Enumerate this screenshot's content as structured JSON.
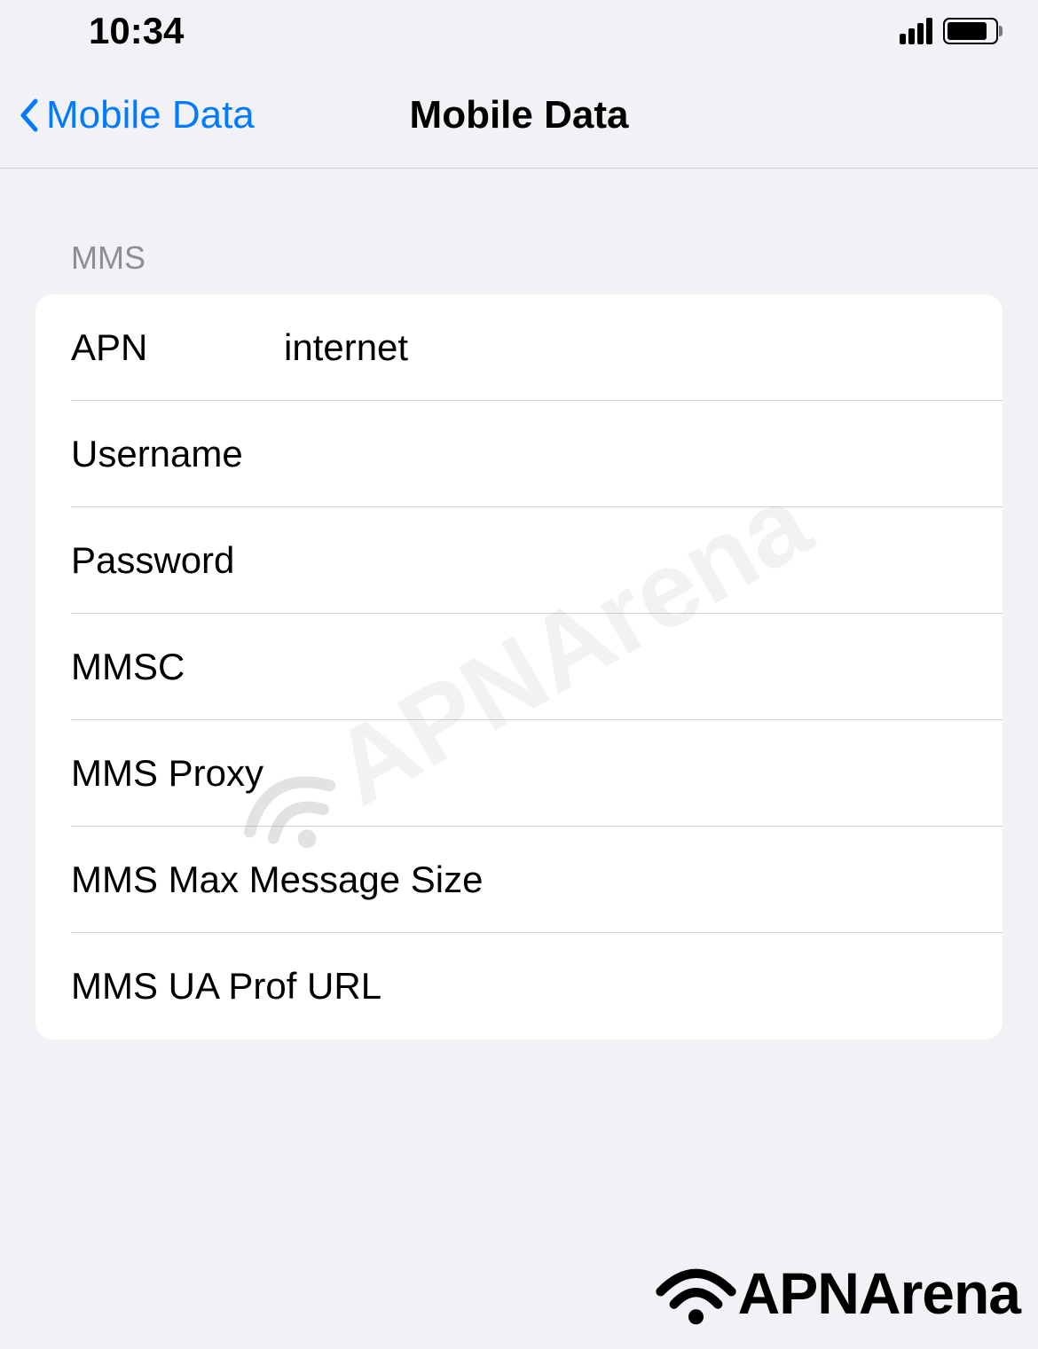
{
  "statusBar": {
    "time": "10:34"
  },
  "navBar": {
    "backLabel": "Mobile Data",
    "title": "Mobile Data"
  },
  "section": {
    "header": "MMS",
    "rows": [
      {
        "label": "APN",
        "value": "internet"
      },
      {
        "label": "Username",
        "value": ""
      },
      {
        "label": "Password",
        "value": ""
      },
      {
        "label": "MMSC",
        "value": ""
      },
      {
        "label": "MMS Proxy",
        "value": ""
      },
      {
        "label": "MMS Max Message Size",
        "value": ""
      },
      {
        "label": "MMS UA Prof URL",
        "value": ""
      }
    ]
  },
  "watermark": {
    "text": "APNArena"
  },
  "brand": {
    "text": "APNArena"
  }
}
